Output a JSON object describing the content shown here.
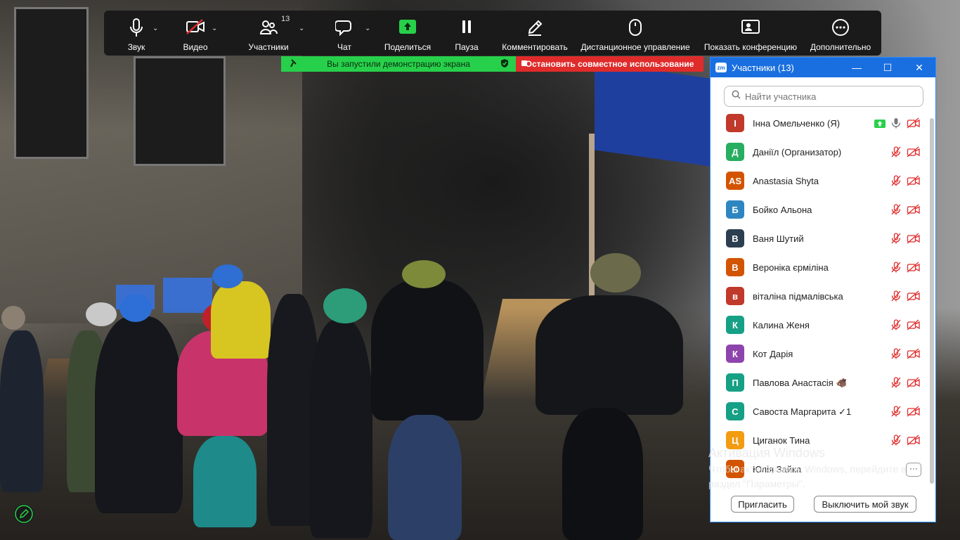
{
  "toolbar": {
    "items": [
      {
        "label": "Звук",
        "icon": "microphone-icon"
      },
      {
        "label": "Видео",
        "icon": "video-off-icon"
      },
      {
        "label": "Участники",
        "icon": "participants-icon",
        "count": "13"
      },
      {
        "label": "Чат",
        "icon": "chat-icon"
      },
      {
        "label": "Поделиться",
        "icon": "share-screen-icon"
      },
      {
        "label": "Пауза",
        "icon": "pause-icon"
      },
      {
        "label": "Комментировать",
        "icon": "annotate-pencil-icon"
      },
      {
        "label": "Дистанционное управление",
        "icon": "mouse-icon"
      },
      {
        "label": "Показать конференцию",
        "icon": "show-meeting-icon"
      },
      {
        "label": "Дополнительно",
        "icon": "more-icon"
      }
    ]
  },
  "share_bar": {
    "status_text": "Вы запустили демонстрацию экрана",
    "stop_text": "Остановить совместное использование"
  },
  "panel": {
    "title": "Участники (13)",
    "search_placeholder": "Найти участника",
    "participants": [
      {
        "initial": "І",
        "name": "Інна Омельченко (Я)",
        "color": "#c0392b",
        "sharing": true,
        "mic": "on"
      },
      {
        "initial": "Д",
        "name": "Даніїл (Организатор)",
        "color": "#27ae60",
        "mic": "muted"
      },
      {
        "initial": "AS",
        "name": "Anastasia Shyta",
        "color": "#d35400",
        "mic": "muted"
      },
      {
        "initial": "Б",
        "name": "Бойко Альона",
        "color": "#2e86c1",
        "mic": "muted"
      },
      {
        "initial": "В",
        "name": "Ваня Шутий",
        "color": "#2c3e50",
        "mic": "muted"
      },
      {
        "initial": "В",
        "name": "Вероніка єрміліна",
        "color": "#d35400",
        "mic": "muted"
      },
      {
        "initial": "в",
        "name": "віталіна підмалівська",
        "color": "#c0392b",
        "mic": "muted"
      },
      {
        "initial": "К",
        "name": "Калина Женя",
        "color": "#16a085",
        "mic": "muted"
      },
      {
        "initial": "К",
        "name": "Кот Дарія",
        "color": "#8e44ad",
        "mic": "muted"
      },
      {
        "initial": "П",
        "name": "Павлова Анастасія 🐗",
        "color": "#16a085",
        "mic": "muted"
      },
      {
        "initial": "С",
        "name": "Савоста Маргарита ✓1",
        "color": "#16a085",
        "mic": "muted"
      },
      {
        "initial": "Ц",
        "name": "Циганок Тина",
        "color": "#f39c12",
        "mic": "muted"
      },
      {
        "initial": "Ю",
        "name": "Юлія Зайка",
        "color": "#d35400",
        "mic": "more"
      }
    ],
    "invite_label": "Пригласить",
    "mute_self_label": "Выключить мой звук",
    "more_label": "···"
  },
  "watermark": {
    "line1": "Активация Windows",
    "line2": "Чтобы активировать Windows, перейдите в раздел \"Параметры\"."
  }
}
